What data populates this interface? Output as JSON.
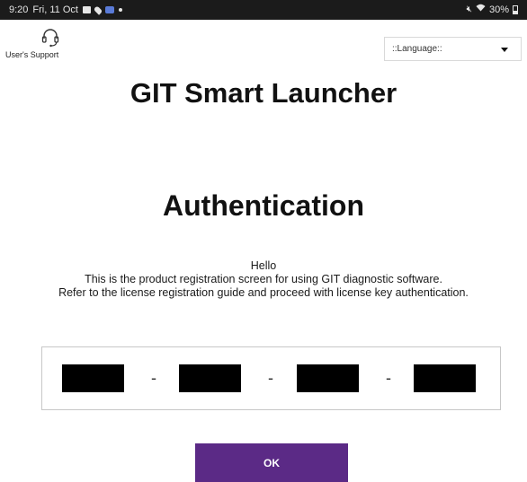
{
  "status_bar": {
    "time": "9:20",
    "date": "Fri, 11 Oct",
    "battery": "30%",
    "icons": [
      "gallery-icon",
      "location-pin-icon",
      "app-notification-icon",
      "dot-icon",
      "mute-icon",
      "wifi-icon",
      "battery-icon"
    ]
  },
  "support": {
    "label": "User's Support",
    "icon": "headset-icon"
  },
  "language": {
    "selected": "::Language::"
  },
  "app_title": "GIT Smart Launcher",
  "auth_title": "Authentication",
  "message": {
    "line1": "Hello",
    "line2": "This is the product registration screen for using GIT diagnostic software.",
    "line3": "Refer to the license registration guide and proceed with license key authentication."
  },
  "license_key": {
    "separator": "-",
    "fields": [
      "",
      "",
      "",
      ""
    ]
  },
  "ok_button": {
    "label": "OK"
  },
  "colors": {
    "status_bar_bg": "#1b1b1b",
    "primary_button": "#5b2a86",
    "key_field_fill": "#000000"
  }
}
